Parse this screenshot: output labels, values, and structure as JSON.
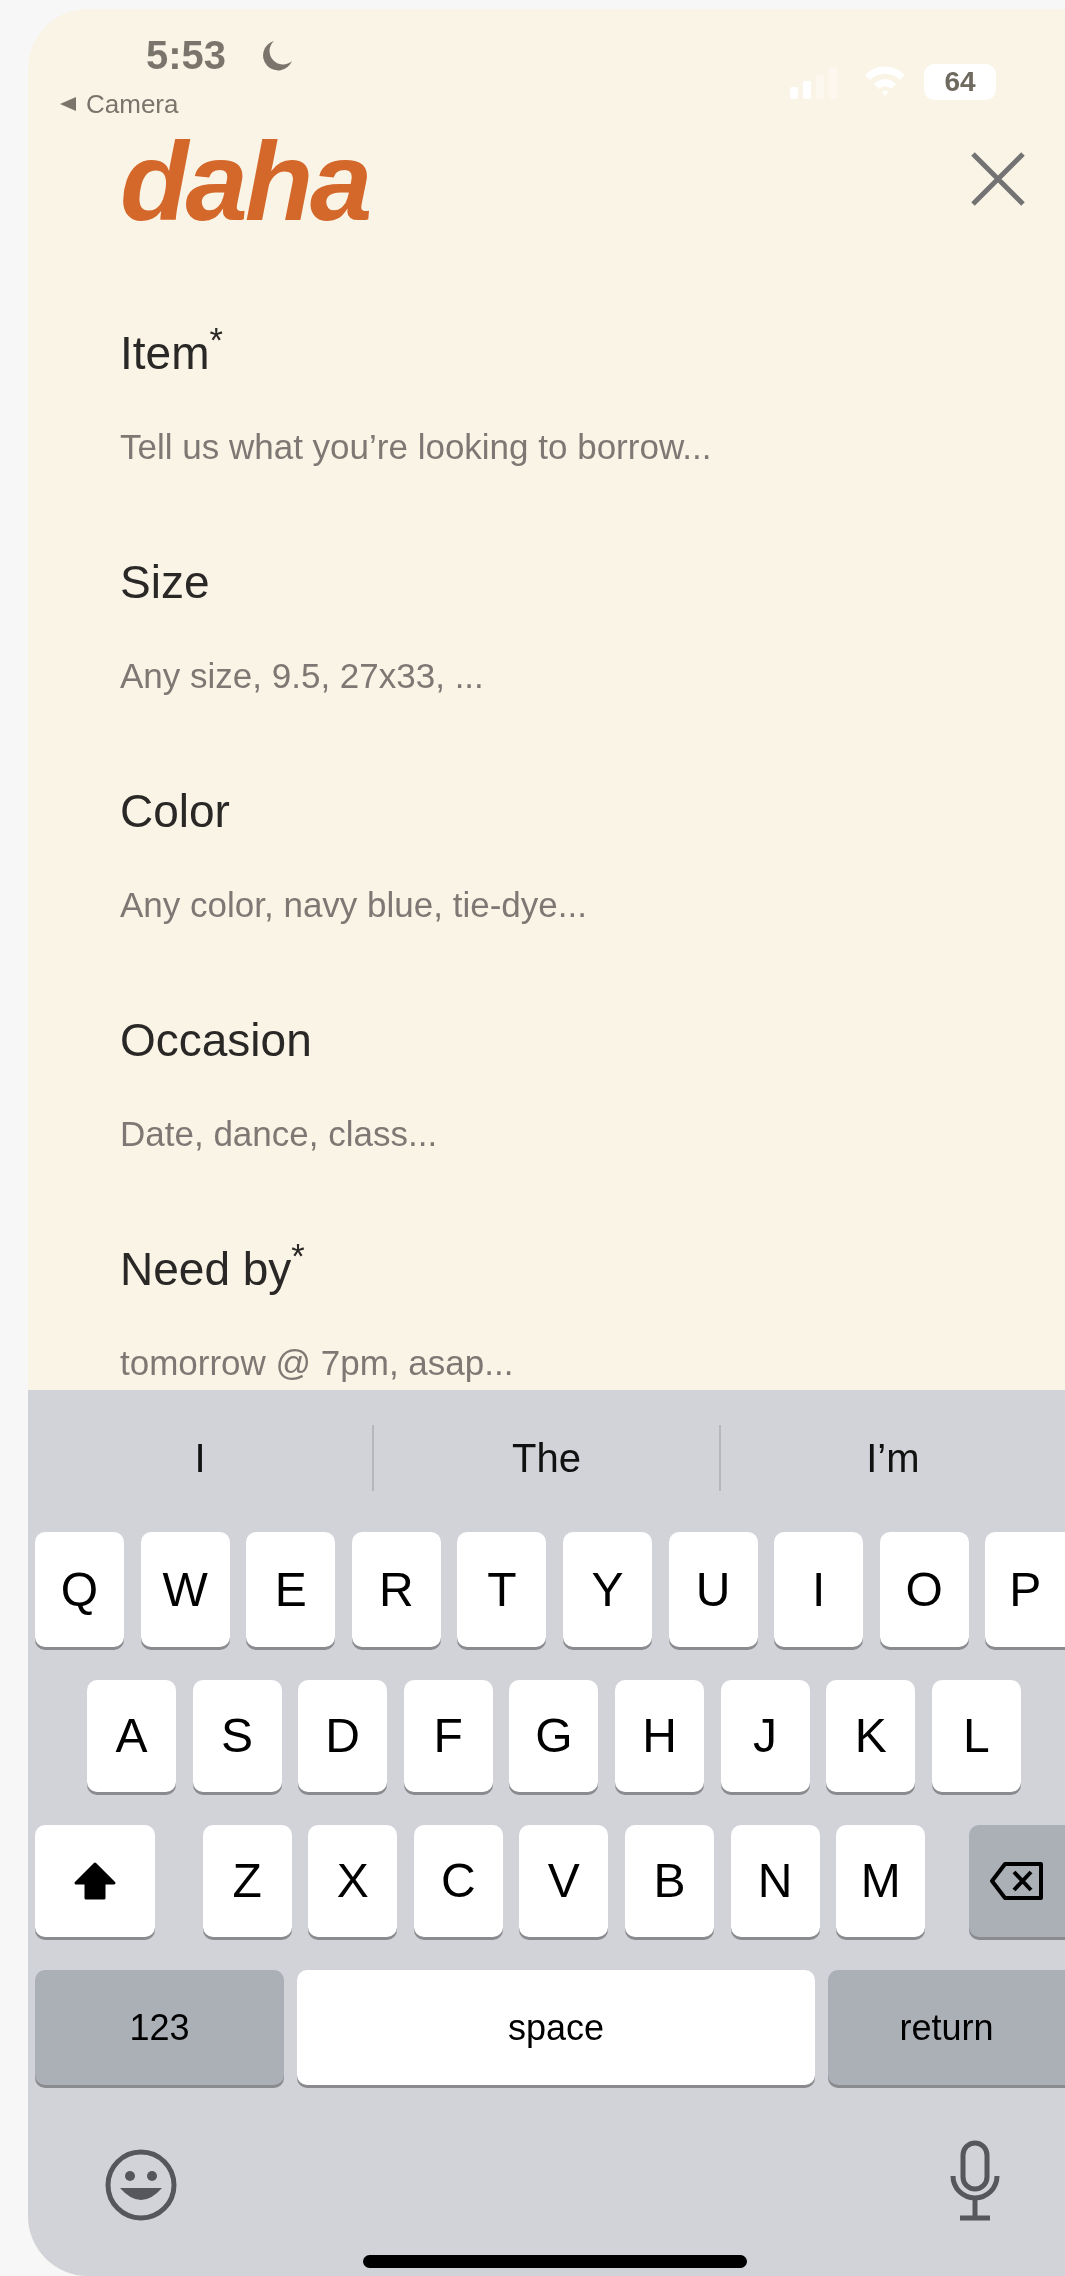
{
  "status_bar": {
    "time": "5:53",
    "back_link": "Camera",
    "battery": "64"
  },
  "header": {
    "logo": "daha"
  },
  "fields": [
    {
      "label": "Item$^{*}$",
      "placeholder": "Tell us what you’re looking to borrow..."
    },
    {
      "label": "Size",
      "placeholder": "Any size, 9.5, 27x33, ..."
    },
    {
      "label": "Color",
      "placeholder": "Any color, navy blue, tie-dye..."
    },
    {
      "label": "Occasion",
      "placeholder": "Date, dance, class..."
    },
    {
      "label": "Need by$^{*}$",
      "placeholder": "tomorrow @ 7pm, asap..."
    }
  ],
  "keyboard": {
    "suggestions": [
      "I",
      "The",
      "I’m"
    ],
    "rows": [
      {
        "keys": [
          {
            "kind": "letter",
            "label": "Q"
          },
          {
            "kind": "letter",
            "label": "W"
          },
          {
            "kind": "letter",
            "label": "E"
          },
          {
            "kind": "letter",
            "label": "R"
          },
          {
            "kind": "letter",
            "label": "T"
          },
          {
            "kind": "letter",
            "label": "Y"
          },
          {
            "kind": "letter",
            "label": "U"
          },
          {
            "kind": "letter",
            "label": "I"
          },
          {
            "kind": "letter",
            "label": "O"
          },
          {
            "kind": "letter",
            "label": "P"
          }
        ]
      },
      {
        "keys": [
          {
            "kind": "letter",
            "label": "A"
          },
          {
            "kind": "letter",
            "label": "S"
          },
          {
            "kind": "letter",
            "label": "D"
          },
          {
            "kind": "letter",
            "label": "F"
          },
          {
            "kind": "letter",
            "label": "G"
          },
          {
            "kind": "letter",
            "label": "H"
          },
          {
            "kind": "letter",
            "label": "J"
          },
          {
            "kind": "letter",
            "label": "K"
          },
          {
            "kind": "letter",
            "label": "L"
          }
        ]
      },
      {
        "keys": [
          {
            "kind": "shift",
            "on": true
          },
          {
            "kind": "letter",
            "label": "Z"
          },
          {
            "kind": "letter",
            "label": "X"
          },
          {
            "kind": "letter",
            "label": "C"
          },
          {
            "kind": "letter",
            "label": "V"
          },
          {
            "kind": "letter",
            "label": "B"
          },
          {
            "kind": "letter",
            "label": "N"
          },
          {
            "kind": "letter",
            "label": "M"
          },
          {
            "kind": "backspace"
          }
        ]
      },
      {
        "keys": [
          {
            "kind": "mode",
            "label": "123"
          },
          {
            "kind": "space",
            "label": "space"
          },
          {
            "kind": "return",
            "label": "return"
          }
        ]
      }
    ]
  }
}
